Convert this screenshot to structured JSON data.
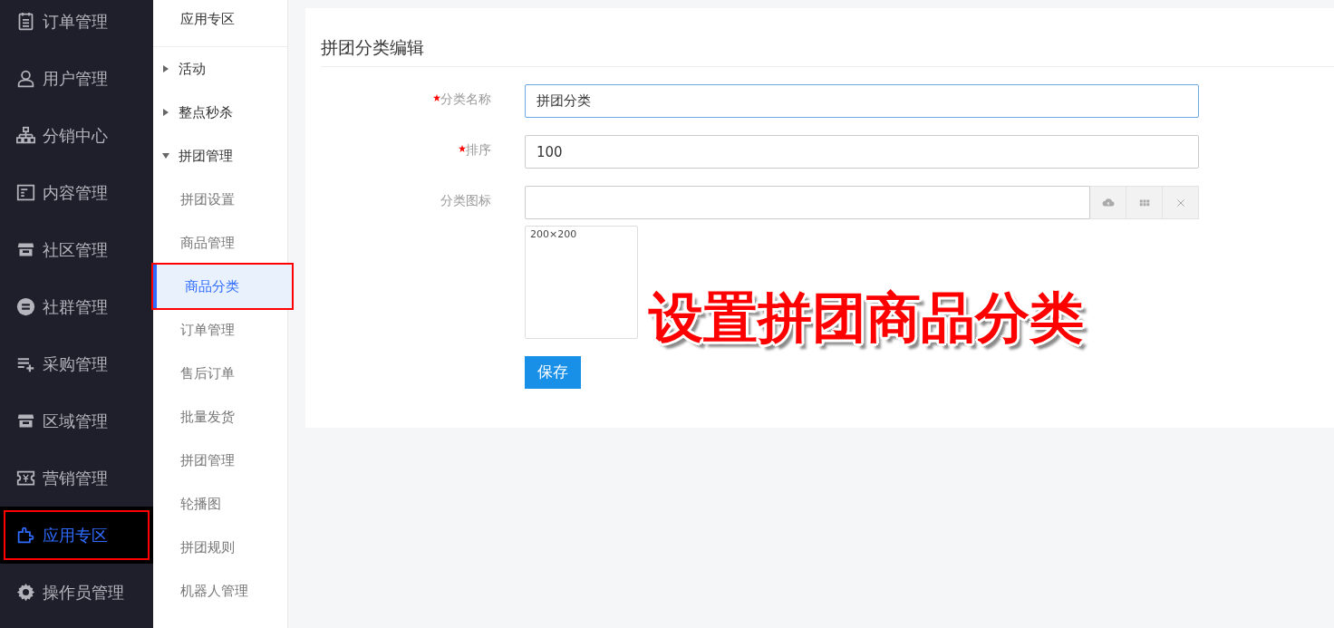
{
  "main_nav": [
    {
      "label": "订单管理",
      "selected": false,
      "highlighted": false
    },
    {
      "label": "用户管理",
      "selected": false,
      "highlighted": false
    },
    {
      "label": "分销中心",
      "selected": false,
      "highlighted": false
    },
    {
      "label": "内容管理",
      "selected": false,
      "highlighted": false
    },
    {
      "label": "社区管理",
      "selected": false,
      "highlighted": false
    },
    {
      "label": "社群管理",
      "selected": false,
      "highlighted": false
    },
    {
      "label": "采购管理",
      "selected": false,
      "highlighted": false
    },
    {
      "label": "区域管理",
      "selected": false,
      "highlighted": false
    },
    {
      "label": "营销管理",
      "selected": false,
      "highlighted": false
    },
    {
      "label": "应用专区",
      "selected": true,
      "highlighted": true
    },
    {
      "label": "操作员管理",
      "selected": false,
      "highlighted": false
    }
  ],
  "sub_nav": {
    "title": "应用专区",
    "items": [
      {
        "label": "活动",
        "expanded": false
      },
      {
        "label": "整点秒杀",
        "expanded": false
      },
      {
        "label": "拼团管理",
        "expanded": true,
        "children": [
          {
            "label": "拼团设置",
            "selected": false,
            "highlighted": false
          },
          {
            "label": "商品管理",
            "selected": false,
            "highlighted": false
          },
          {
            "label": "商品分类",
            "selected": true,
            "highlighted": true
          },
          {
            "label": "订单管理",
            "selected": false,
            "highlighted": false
          },
          {
            "label": "售后订单",
            "selected": false,
            "highlighted": false
          },
          {
            "label": "批量发货",
            "selected": false,
            "highlighted": false
          },
          {
            "label": "拼团管理",
            "selected": false,
            "highlighted": false
          },
          {
            "label": "轮播图",
            "selected": false,
            "highlighted": false
          },
          {
            "label": "拼团规则",
            "selected": false,
            "highlighted": false
          },
          {
            "label": "机器人管理",
            "selected": false,
            "highlighted": false
          }
        ]
      }
    ]
  },
  "form": {
    "title": "拼团分类编辑",
    "fields": [
      {
        "kind": "text",
        "label": "分类名称",
        "required": true,
        "value": "拼团分类",
        "focused": true
      },
      {
        "kind": "text",
        "label": "排序",
        "required": true,
        "value": "100",
        "focused": false
      },
      {
        "kind": "image",
        "label": "分类图标",
        "required": false,
        "preview": "200×200"
      }
    ],
    "save_button": "保存"
  },
  "annotation": {
    "text": "设置拼团商品分类"
  }
}
